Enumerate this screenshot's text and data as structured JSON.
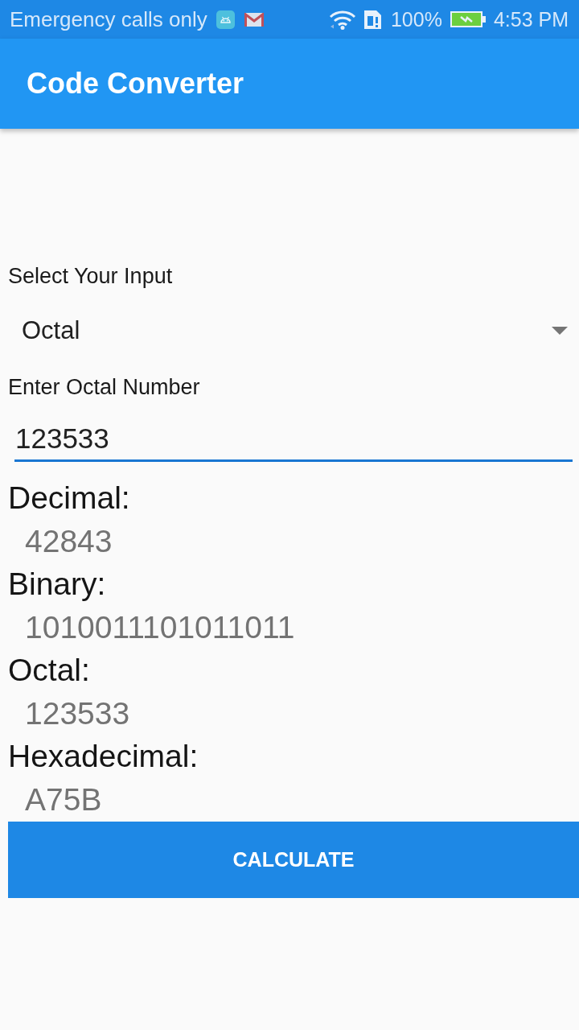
{
  "status_bar": {
    "carrier_text": "Emergency calls only",
    "battery_percent": "100%",
    "time": "4:53 PM"
  },
  "app_bar": {
    "title": "Code Converter"
  },
  "input_type": {
    "label": "Select Your Input",
    "value": "Octal"
  },
  "number_field": {
    "label": "Enter Octal Number",
    "value": "123533",
    "focused": true
  },
  "results": [
    {
      "label": "Decimal:",
      "value": "42843"
    },
    {
      "label": "Binary:",
      "value": "1010011101011011"
    },
    {
      "label": "Octal:",
      "value": "123533"
    },
    {
      "label": "Hexadecimal:",
      "value": "A75B"
    }
  ],
  "calculate_button": {
    "label": "CALCULATE"
  }
}
